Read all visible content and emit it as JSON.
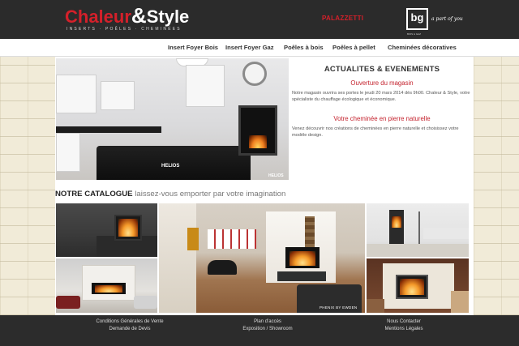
{
  "header": {
    "logo": {
      "part1": "Chaleur",
      "amp": "&",
      "part2": "Style",
      "tagline": "INSERTS · POÊLES · CHEMINÉES"
    },
    "partner_brand": "PALAZZETTI",
    "group_logo": "bg",
    "group_logo_sub": "BOIS & GAZ",
    "group_tagline": "a part of you"
  },
  "nav": {
    "items": [
      {
        "label": "Insert Foyer Bois"
      },
      {
        "label": "Insert Foyer Gaz"
      },
      {
        "label": "Poêles à bois"
      },
      {
        "label": "Poêles à pellet"
      },
      {
        "label": "Cheminées décoratives"
      }
    ]
  },
  "hero": {
    "caption_center": "HELIOS",
    "caption_corner": "HELIOS"
  },
  "news": {
    "title": "ACTUALITES & EVENEMENTS",
    "items": [
      {
        "heading": "Ouverture du magasin",
        "body": "Notre magasin ouvrira ses portes le jeudi 20 mars 2014 dès 9h00. Chaleur & Style, votre spécialiste du chauffage écologique et économique."
      },
      {
        "heading": "Votre cheminée en pierre naturelle",
        "body": "Venez découvrir nos créations de cheminées en pierre naturelle et choisissez votre modèle design."
      }
    ]
  },
  "catalogue": {
    "heading_strong": "NOTRE CATALOGUE",
    "heading_rest": " laissez-vous emporter par votre imagination",
    "caption": "PHENIX BY EWDEN"
  },
  "footer": {
    "col1": [
      "Conditions Générales de Vente",
      "Demande de Devis"
    ],
    "col2": [
      "Plan d'accès",
      "Exposition / Showroom"
    ],
    "col3": [
      "Nous Contacter",
      "Mentions Légales"
    ]
  },
  "colors": {
    "brand_red": "#d4202a",
    "header_bg": "#2b2b2b",
    "news_heading": "#c4232e"
  }
}
